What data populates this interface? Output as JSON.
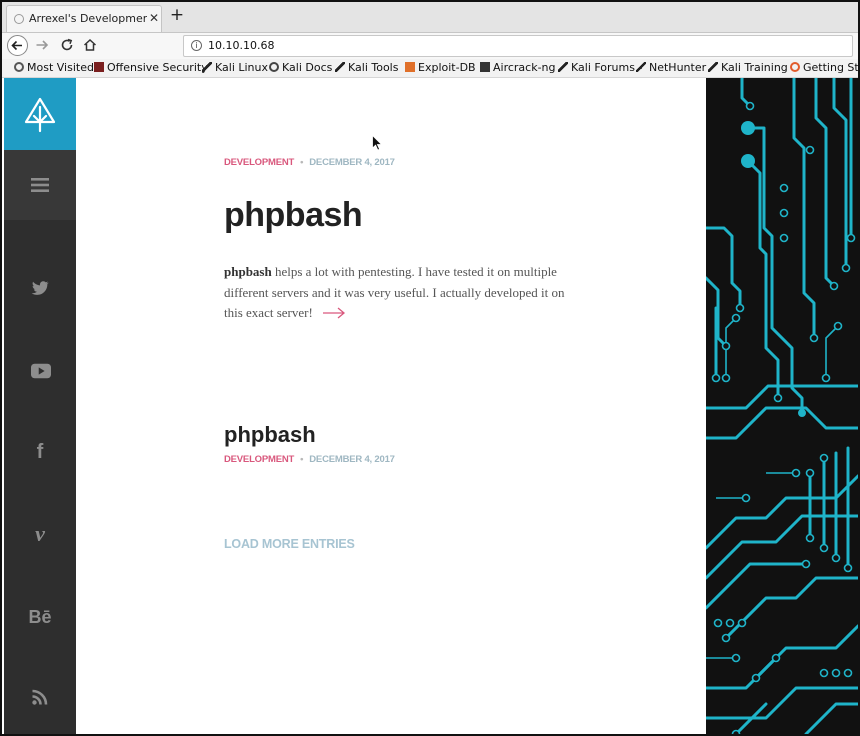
{
  "browser": {
    "tab_title": "Arrexel's Development S",
    "tab_close": "✕",
    "new_tab": "+",
    "url": "10.10.10.68",
    "bookmarks": [
      {
        "label": "Most Visited",
        "icon": "gear-icon"
      },
      {
        "label": "Offensive Security",
        "icon": "offsec-icon"
      },
      {
        "label": "Kali Linux",
        "icon": "kali-dragon-icon"
      },
      {
        "label": "Kali Docs",
        "icon": "globe-icon"
      },
      {
        "label": "Kali Tools",
        "icon": "kali-dragon-icon"
      },
      {
        "label": "Exploit-DB",
        "icon": "exploitdb-icon"
      },
      {
        "label": "Aircrack-ng",
        "icon": "aircrack-icon"
      },
      {
        "label": "Kali Forums",
        "icon": "kali-dragon-icon"
      },
      {
        "label": "NetHunter",
        "icon": "kali-dragon-icon"
      },
      {
        "label": "Kali Training",
        "icon": "kali-dragon-icon"
      },
      {
        "label": "Getting Sta",
        "icon": "firefox-icon"
      }
    ]
  },
  "sidebar": {
    "logo_icon": "tree-logo-icon",
    "menu_icon": "hamburger-icon",
    "social": [
      {
        "name": "twitter-icon"
      },
      {
        "name": "youtube-icon"
      },
      {
        "name": "facebook-icon",
        "glyph": "f"
      },
      {
        "name": "vimeo-icon",
        "glyph": "v"
      },
      {
        "name": "behance-icon",
        "glyph": "Bē"
      },
      {
        "name": "rss-icon"
      }
    ]
  },
  "posts": [
    {
      "category": "DEVELOPMENT",
      "separator": "•",
      "date": "DECEMBER 4, 2017",
      "title": "phpbash",
      "excerpt_bold": "phpbash",
      "excerpt_rest": " helps a lot with pentesting. I have tested it on multiple different servers and it was very useful. I actually developed it on this exact server!"
    },
    {
      "title": "phpbash",
      "category": "DEVELOPMENT",
      "separator": "•",
      "date": "DECEMBER 4, 2017"
    }
  ],
  "load_more": "LOAD MORE ENTRIES",
  "colors": {
    "accent_pink": "#d9587d",
    "date_blue": "#9fb7c2",
    "logo_blue": "#1f9cc4",
    "sidebar_dark": "#2e2e2e",
    "circuit_cyan": "#1fb4c9"
  }
}
